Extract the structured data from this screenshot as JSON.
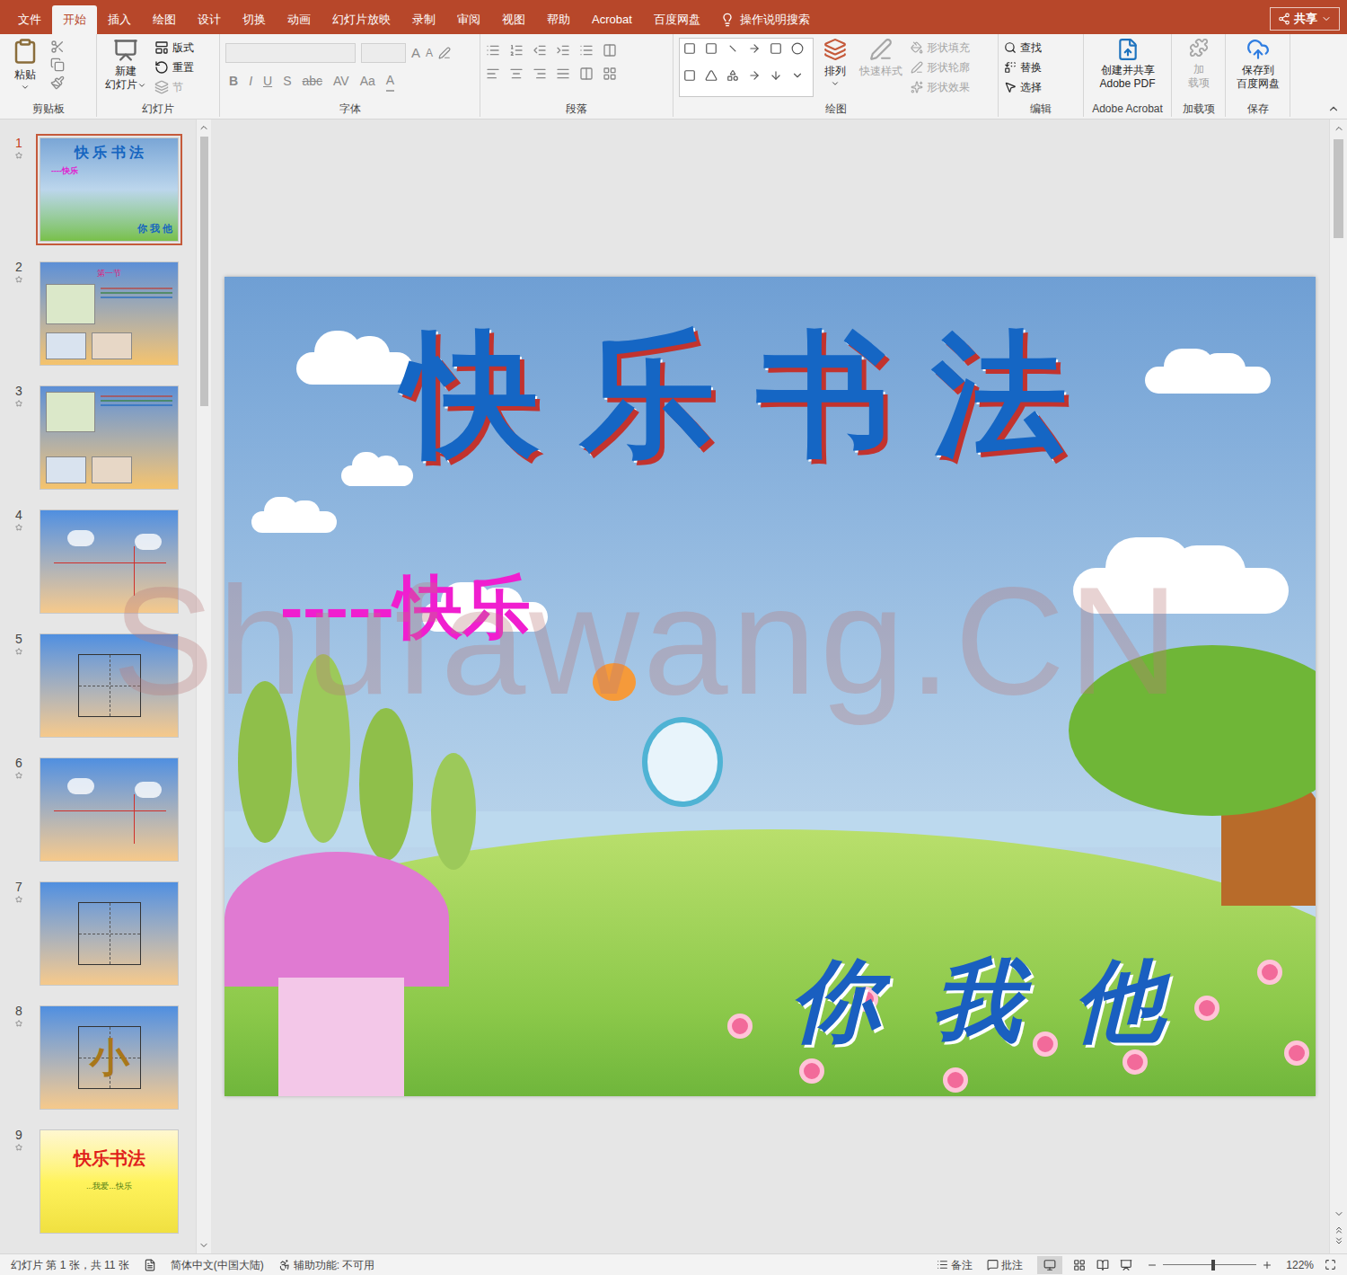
{
  "ribbon_tabs": [
    {
      "label": "文件",
      "selected": false
    },
    {
      "label": "开始",
      "selected": true
    },
    {
      "label": "插入",
      "selected": false
    },
    {
      "label": "绘图",
      "selected": false
    },
    {
      "label": "设计",
      "selected": false
    },
    {
      "label": "切换",
      "selected": false
    },
    {
      "label": "动画",
      "selected": false
    },
    {
      "label": "幻灯片放映",
      "selected": false
    },
    {
      "label": "录制",
      "selected": false
    },
    {
      "label": "审阅",
      "selected": false
    },
    {
      "label": "视图",
      "selected": false
    },
    {
      "label": "帮助",
      "selected": false
    },
    {
      "label": "Acrobat",
      "selected": false
    },
    {
      "label": "百度网盘",
      "selected": false
    }
  ],
  "tell_me": {
    "label": "操作说明搜索"
  },
  "share_button": {
    "label": "共享"
  },
  "ribbon": {
    "clipboard": {
      "label": "剪贴板",
      "paste": "粘贴"
    },
    "slides": {
      "label": "幻灯片",
      "new_slide": [
        "新建",
        "幻灯片"
      ],
      "layout": "版式",
      "reset": "重置",
      "section": "节"
    },
    "font": {
      "label": "字体",
      "disabled": true,
      "size_buttons": [
        "A",
        "A"
      ],
      "format_buttons": [
        "B",
        "I",
        "U",
        "S",
        "abc",
        "AV",
        "Aa"
      ],
      "color_button": "A"
    },
    "paragraph": {
      "label": "段落"
    },
    "drawing": {
      "label": "绘图",
      "arrange": "排列",
      "quick_styles": {
        "label": "快速样式",
        "disabled": true
      },
      "shape_options": [
        {
          "label": "形状填充",
          "disabled": true
        },
        {
          "label": "形状轮廓",
          "disabled": true
        },
        {
          "label": "形状效果",
          "disabled": true
        }
      ]
    },
    "editing": {
      "label": "编辑",
      "items": [
        "查找",
        "替换",
        "选择"
      ]
    },
    "acrobat": {
      "label": "Adobe Acrobat",
      "button": [
        "创建并共享",
        "Adobe PDF"
      ]
    },
    "addins": {
      "label": "加载项",
      "button": [
        "加",
        "载项"
      ],
      "disabled": true
    },
    "save": {
      "label": "保存",
      "button": [
        "保存到",
        "百度网盘"
      ]
    }
  },
  "thumbnails": [
    {
      "number": "1",
      "selected": true,
      "animated": true,
      "kind": "title",
      "texts": [
        "快 乐 书 法",
        "----快乐",
        "你 我 他"
      ]
    },
    {
      "number": "2",
      "selected": false,
      "animated": true,
      "kind": "photos",
      "texts": [
        "第一节"
      ]
    },
    {
      "number": "3",
      "selected": false,
      "animated": true,
      "kind": "photos",
      "texts": []
    },
    {
      "number": "4",
      "selected": false,
      "animated": true,
      "kind": "clouds",
      "texts": []
    },
    {
      "number": "5",
      "selected": false,
      "animated": true,
      "kind": "grid",
      "texts": []
    },
    {
      "number": "6",
      "selected": false,
      "animated": true,
      "kind": "clouds",
      "texts": []
    },
    {
      "number": "7",
      "selected": false,
      "animated": true,
      "kind": "grid",
      "texts": []
    },
    {
      "number": "8",
      "selected": false,
      "animated": true,
      "kind": "grid",
      "texts": [
        "小"
      ]
    },
    {
      "number": "9",
      "selected": false,
      "animated": true,
      "kind": "end",
      "texts": [
        "快乐书法",
        "...我爱...快乐"
      ]
    }
  ],
  "slide": {
    "title": "快乐书法",
    "subtitle": "-----快乐",
    "footer": "你我他"
  },
  "watermark": "Shufawang.CN",
  "status_bar": {
    "slide_info": "幻灯片 第 1 张，共 11 张",
    "language": "简体中文(中国大陆)",
    "accessibility": "辅助功能: 不可用",
    "notes": "备注",
    "comments": "批注",
    "zoom": "122%",
    "zoom_level": 0.52
  }
}
